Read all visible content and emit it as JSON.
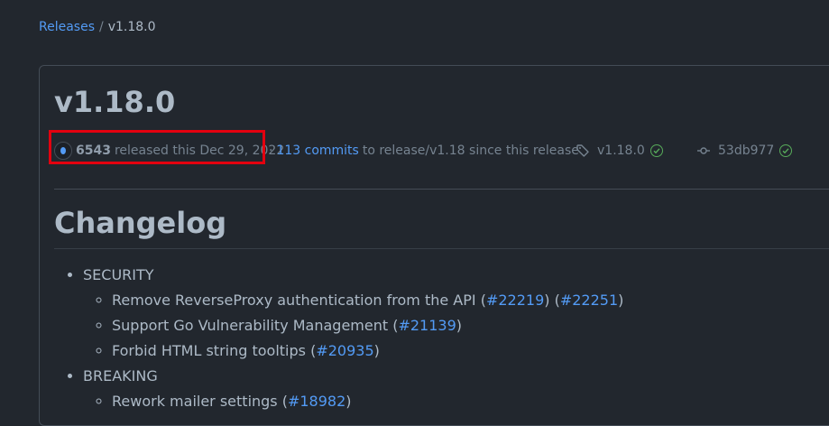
{
  "breadcrumb": {
    "root": "Releases",
    "separator": "/",
    "current": "v1.18.0"
  },
  "release": {
    "title": "v1.18.0",
    "author": "6543",
    "released_text": "released this Dec 29, 2022",
    "commits_prefix": "·",
    "commits_link": "113 commits",
    "commits_suffix": "to release/v1.18 since this release",
    "tag": "v1.18.0",
    "sha": "53db977"
  },
  "changelog": {
    "heading": "Changelog",
    "sections": [
      {
        "name": "SECURITY",
        "items": [
          {
            "text": "Remove ReverseProxy authentication from the API (",
            "links": [
              "#22219",
              "#22251"
            ]
          },
          {
            "text": "Support Go Vulnerability Management (",
            "links": [
              "#21139"
            ]
          },
          {
            "text": "Forbid HTML string tooltips (",
            "links": [
              "#20935"
            ]
          }
        ]
      },
      {
        "name": "BREAKING",
        "items": [
          {
            "text": "Rework mailer settings (",
            "links": [
              "#18982"
            ]
          }
        ]
      }
    ]
  },
  "colors": {
    "background": "#22272e",
    "link": "#539bf5",
    "highlight": "#e3000f",
    "success": "#57ab5a"
  }
}
